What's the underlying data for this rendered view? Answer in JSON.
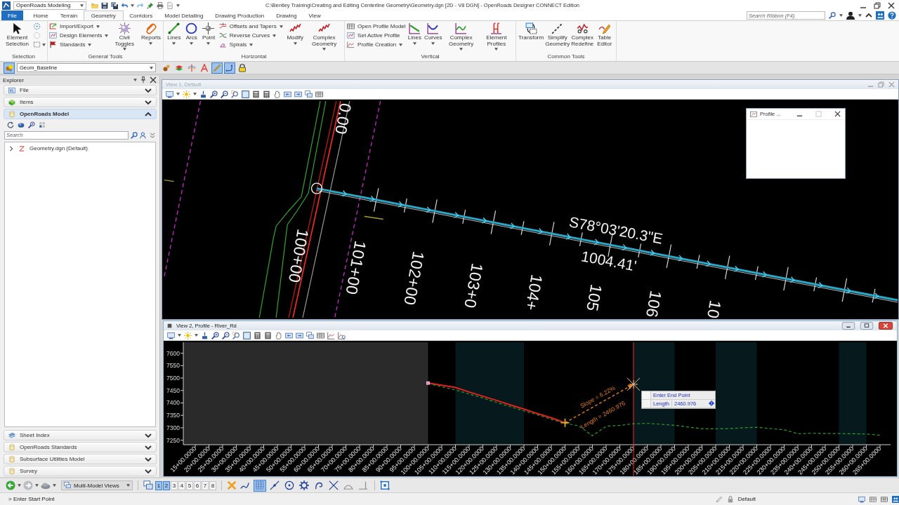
{
  "title_bar": {
    "workflow": "OpenRoads Modeling",
    "title": "C:\\Bentley Training\\Creating and Editing Centerline Geometry\\Geometry.dgn [2D - V8 DGN] - OpenRoads Designer CONNECT Edition"
  },
  "ribbon_tabs": [
    {
      "label": "File",
      "kind": "backstage",
      "selected": false
    },
    {
      "label": "Home",
      "kind": "tab",
      "selected": false
    },
    {
      "label": "Terrain",
      "kind": "tab",
      "selected": false
    },
    {
      "label": "Geometry",
      "kind": "tab",
      "selected": true
    },
    {
      "label": "Corridors",
      "kind": "tab",
      "selected": false
    },
    {
      "label": "Model Detailing",
      "kind": "tab",
      "selected": false
    },
    {
      "label": "Drawing Production",
      "kind": "tab",
      "selected": false
    },
    {
      "label": "Drawing",
      "kind": "tab",
      "selected": false
    },
    {
      "label": "View",
      "kind": "tab",
      "selected": false
    }
  ],
  "ribbon_search": {
    "placeholder": "Search Ribbon (F4)"
  },
  "ribbon_groups": [
    {
      "title": "Selection",
      "tools": [
        {
          "kind": "large",
          "label": "Element Selection",
          "dropdown": false
        },
        {
          "kind": "icon",
          "dropdown": false
        },
        {
          "kind": "icon",
          "dropdown": false
        },
        {
          "kind": "icon",
          "dropdown": true
        }
      ]
    },
    {
      "title": "General Tools",
      "tools": [
        {
          "kind": "small",
          "label": "Import/Export",
          "dropdown": true
        },
        {
          "kind": "small",
          "label": "Design Elements",
          "dropdown": true
        },
        {
          "kind": "small",
          "label": "Standards",
          "dropdown": true
        },
        {
          "kind": "large",
          "label": "Civil Toggles",
          "dropdown": true
        },
        {
          "kind": "large",
          "label": "Reports",
          "dropdown": true
        }
      ]
    },
    {
      "title": "Horizontal",
      "tools": [
        {
          "kind": "large",
          "label": "Lines",
          "dropdown": true
        },
        {
          "kind": "large",
          "label": "Arcs",
          "dropdown": true
        },
        {
          "kind": "large",
          "label": "Point",
          "dropdown": true
        },
        {
          "kind": "small",
          "label": "Offsets and Tapers",
          "dropdown": true
        },
        {
          "kind": "small",
          "label": "Reverse Curves",
          "dropdown": true
        },
        {
          "kind": "small",
          "label": "Spirals",
          "dropdown": true
        },
        {
          "kind": "large",
          "label": "Modify",
          "dropdown": true
        },
        {
          "kind": "large",
          "label": "Complex Geometry",
          "dropdown": true
        }
      ]
    },
    {
      "title": "Vertical",
      "tools": [
        {
          "kind": "small",
          "label": "Open Profile Model",
          "dropdown": false
        },
        {
          "kind": "small",
          "label": "Set Active Profile",
          "dropdown": false
        },
        {
          "kind": "small",
          "label": "Profile Creation",
          "dropdown": true
        },
        {
          "kind": "large",
          "label": "Lines",
          "dropdown": true
        },
        {
          "kind": "large",
          "label": "Curves",
          "dropdown": true
        },
        {
          "kind": "large",
          "label": "Complex Geometry",
          "dropdown": true
        },
        {
          "kind": "large",
          "label": "Element Profiles",
          "dropdown": true
        }
      ]
    },
    {
      "title": "Common Tools",
      "tools": [
        {
          "kind": "large",
          "label": "Transform",
          "dropdown": false
        },
        {
          "kind": "large",
          "label": "Simplify Geometry",
          "dropdown": false
        },
        {
          "kind": "large",
          "label": "Complex Redefine",
          "dropdown": false
        },
        {
          "kind": "large",
          "label": "Table Editor",
          "dropdown": false
        }
      ]
    }
  ],
  "attribute_bar": {
    "left_toggle": {
      "on": true
    },
    "template": "Geom_Baseline",
    "toggles": [
      {
        "on": false
      },
      {
        "on": false
      },
      {
        "on": false
      },
      {
        "on": false
      },
      {
        "on": true
      },
      {
        "on": true
      },
      {
        "on": false
      }
    ]
  },
  "explorer": {
    "title": "Explorer",
    "sections": [
      {
        "label": "File",
        "expanded": false
      },
      {
        "label": "Items",
        "expanded": false
      },
      {
        "label": "OpenRoads Model",
        "expanded": true,
        "search_placeholder": "Search",
        "tree": [
          {
            "label": "Geometry.dgn (Default)",
            "expanded": false
          }
        ]
      },
      {
        "label": "Sheet Index",
        "expanded": false
      },
      {
        "label": "OpenRoads Standards",
        "expanded": false
      },
      {
        "label": "Subsurface Utilities Model",
        "expanded": false
      },
      {
        "label": "Survey",
        "expanded": false
      }
    ]
  },
  "view_1": {
    "title": "View 1, Default",
    "active": false,
    "plan": {
      "top_label": "0.00",
      "station_labels": [
        "100+00",
        "101+00",
        "102+00",
        "103+0",
        "104+",
        "105",
        "106",
        "10"
      ],
      "bearing": "S78°03'20.3\"E",
      "distance": "1004.41'"
    }
  },
  "profile_dialog": {
    "title": "Profile ..."
  },
  "view_2": {
    "title": "View 2, Profile - River_Rd",
    "active": true,
    "chart_data": {
      "type": "line",
      "categories": [
        "15+00.0000",
        "20+00.0000",
        "25+00.0000",
        "30+00.0000",
        "35+00.0000",
        "40+00.0000",
        "45+00.0000",
        "50+00.0000",
        "55+00.0000",
        "60+00.0000",
        "65+00.0000",
        "70+00.0000",
        "75+00.0000",
        "80+00.0000",
        "85+00.0000",
        "90+00.0000",
        "95+00.0000",
        "100+00.0000",
        "105+00.0000",
        "110+00.0000",
        "115+00.0000",
        "120+00.0000",
        "125+00.0000",
        "130+00.0000",
        "135+00.0000",
        "140+00.0000",
        "145+00.0000",
        "150+00.0000",
        "155+00.0000",
        "160+00.0000",
        "165+00.0000",
        "170+00.0000",
        "175+00.0000",
        "180+00.0000",
        "185+00.0000",
        "190+00.0000",
        "195+00.0000",
        "200+00.0000",
        "205+00.0000",
        "210+00.0000",
        "215+00.0000",
        "220+00.0000",
        "225+00.0000",
        "230+00.0000",
        "235+00.0000",
        "240+00.0000",
        "245+00.0000",
        "250+00.0000",
        "255+00.0000",
        "260+00.0000",
        "265+00.0000"
      ],
      "ylim": [
        7232,
        7644
      ],
      "yticks": [
        7250,
        7300,
        7350,
        7400,
        7450,
        7500,
        7550,
        7600
      ],
      "series": [
        {
          "color": "#e8201c",
          "line_style": "solid",
          "values": [
            null,
            null,
            null,
            null,
            null,
            null,
            null,
            null,
            null,
            null,
            null,
            null,
            null,
            null,
            null,
            null,
            null,
            7480,
            7471,
            7462,
            7444,
            7427,
            7410,
            7392,
            7375,
            7357,
            7340,
            7320,
            null,
            null,
            null,
            null,
            null,
            null,
            null,
            null,
            null,
            null,
            null,
            null,
            null,
            null,
            null,
            null,
            null,
            null,
            null,
            null,
            null,
            null,
            null
          ]
        },
        {
          "color": "#2e9a2e",
          "line_style": "dashed",
          "values": [
            null,
            null,
            null,
            null,
            null,
            null,
            null,
            null,
            null,
            null,
            null,
            null,
            null,
            null,
            null,
            null,
            null,
            7478,
            7465,
            7452,
            7436,
            7420,
            7402,
            7385,
            7368,
            7352,
            7334,
            7318,
            7308,
            7268,
            7306,
            7310,
            7316,
            7318,
            7314,
            7310,
            7303,
            7296,
            7296,
            7297,
            7300,
            7302,
            7297,
            7292,
            7276,
            7278,
            7277,
            7277,
            7276,
            7275,
            7270
          ]
        },
        {
          "color": "#e07a1e",
          "line_style": "dashed",
          "values": [
            null,
            null,
            null,
            null,
            null,
            null,
            null,
            null,
            null,
            null,
            null,
            null,
            null,
            null,
            null,
            null,
            null,
            null,
            null,
            null,
            null,
            null,
            null,
            null,
            null,
            null,
            null,
            7320,
            7351,
            7382,
            7413,
            7444,
            7475,
            null,
            null,
            null,
            null,
            null,
            null,
            null,
            null,
            null,
            null,
            null,
            null,
            null,
            null,
            null,
            null,
            null,
            null
          ]
        }
      ],
      "bands": [
        {
          "axis": "x",
          "from": "110+00.0000",
          "to": "135+00.0000",
          "color": "#061a1d"
        },
        {
          "axis": "x",
          "from": "175+00.0000",
          "to": "190+00.0000",
          "color": "#061a1d"
        },
        {
          "axis": "x",
          "from": "205+00.0000",
          "to": "220+00.0000",
          "color": "#061a1d"
        },
        {
          "axis": "x",
          "from": "250+00.0000",
          "to": "260+00.0000",
          "color": "#061a1d"
        }
      ],
      "ref_lines": [
        {
          "axis": "x",
          "value": "175+00.0000",
          "color": "#d42020"
        }
      ],
      "annotations": [
        "Slope = 6.22%",
        "Length = 2460.976"
      ]
    },
    "prompt": {
      "title": "Enter End Point",
      "label": "Length",
      "value": "2460.976"
    }
  },
  "view_bar": {
    "view_set": "Multi-Model Views",
    "views": [
      {
        "label": "1",
        "selected": true
      },
      {
        "label": "2",
        "selected": true
      },
      {
        "label": "3",
        "selected": false
      },
      {
        "label": "4",
        "selected": false
      },
      {
        "label": "5",
        "selected": false
      },
      {
        "label": "6",
        "selected": false
      },
      {
        "label": "7",
        "selected": false
      },
      {
        "label": "8",
        "selected": false
      }
    ],
    "snaps": [
      {
        "on": false
      },
      {
        "on": true
      },
      {
        "on": false
      },
      {
        "on": false
      },
      {
        "on": false
      },
      {
        "on": false
      },
      {
        "on": false
      },
      {
        "on": false
      },
      {
        "on": false
      }
    ]
  },
  "status_bar": {
    "prompt": "> Enter Start Point",
    "right_field": "Default"
  }
}
